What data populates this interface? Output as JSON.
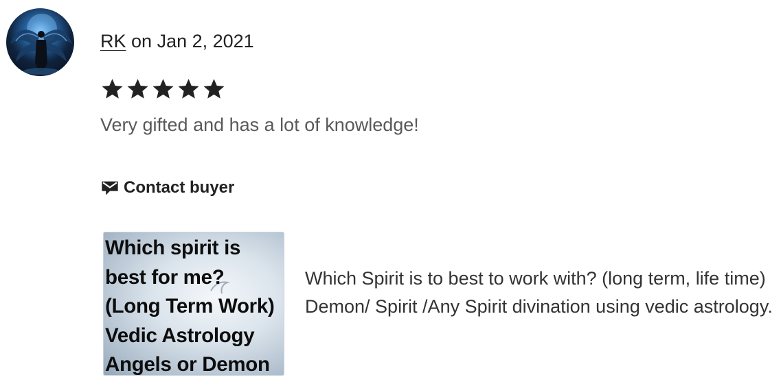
{
  "review": {
    "reviewer_name": "RK",
    "date_text": "on Jan 2, 2021",
    "rating": 5,
    "rating_max": 5,
    "text": "Very gifted and has a lot of knowledge!",
    "contact_label": "Contact buyer",
    "avatar_icon": "dark-winged-figure-avatar"
  },
  "listing": {
    "thumbnail_lines": [
      "Which spirit is",
      "best for me?",
      "(Long Term Work)",
      "Vedic Astrology",
      "Angels or Demon"
    ],
    "title": "Which Spirit is to best to work with? (long term, life time) Demon/ Spirit /Any Spirit divination using vedic astrology."
  },
  "icons": {
    "star": "star-icon",
    "contact": "envelope-icon"
  },
  "colors": {
    "text": "#222222",
    "muted_text": "#595959",
    "star": "#222222"
  }
}
